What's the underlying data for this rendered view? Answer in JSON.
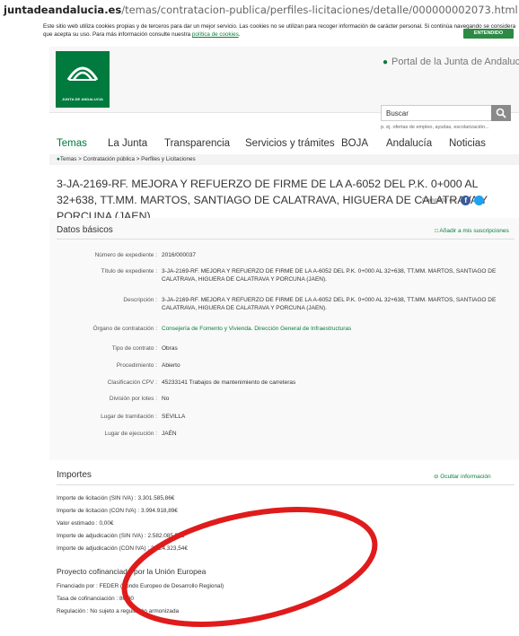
{
  "url": {
    "domain": "juntadeandalucia.es",
    "path": "/temas/contratacion-publica/perfiles-licitaciones/detalle/000000002073.html"
  },
  "cookie_banner": {
    "text": "Este sitio web utiliza cookies propias y de terceros para dar un mejor servicio. Las cookies no se utilizan para recoger información de carácter personal. Si continúa navegando se considera que acepta su uso. Para más información consulte nuestra",
    "link": "política de cookies",
    "button": "ENTENDIDO"
  },
  "header": {
    "logo_text": "JUNTA DE ANDALUCIA",
    "portal_link": "Portal de la Junta de Andalucía",
    "search_value": "Buscar",
    "search_hint": "p. ej. ofertas de empleo, ayudas, escolarización..."
  },
  "nav": [
    "Temas",
    "La Junta",
    "Transparencia",
    "Servicios y trámites",
    "BOJA",
    "Andalucía",
    "Noticias"
  ],
  "breadcrumb": [
    "Temas",
    "Contratación pública",
    "Perfiles y Licitaciones"
  ],
  "title": "3-JA-2169-RF. MEJORA Y REFUERZO DE FIRME DE LA A-6052 DEL P.K. 0+000 AL 32+638, TT.MM. MARTOS, SANTIAGO DE CALATRAVA, HIGUERA DE CALATRAVA Y PORCUNA (JAEN).",
  "share_label": "Compartir en:",
  "datos": {
    "heading": "Datos básicos",
    "subscribe_link": "Añadir a mis suscripciones",
    "rows": [
      {
        "label": "Número de expediente :",
        "value": "2016/000037"
      },
      {
        "label": "Título de expediente :",
        "value": "3-JA-2169-RF. MEJORA Y REFUERZO DE FIRME DE LA A-6052 DEL P.K. 0+000 AL 32+638, TT.MM. MARTOS, SANTIAGO DE CALATRAVA, HIGUERA DE CALATRAVA Y PORCUNA (JAEN)."
      },
      {
        "label": "Descripción :",
        "value": "3-JA-2169-RF. MEJORA Y REFUERZO DE FIRME DE LA A-6052 DEL P.K. 0+000 AL 32+638, TT.MM. MARTOS, SANTIAGO DE CALATRAVA, HIGUERA DE CALATRAVA Y PORCUNA (JAEN)."
      },
      {
        "label": "Órgano de contratación :",
        "value": "Consejería de Fomento y Vivienda. Dirección General de Infraestructuras"
      },
      {
        "label": "Tipo de contrato :",
        "value": "Obras"
      },
      {
        "label": "Procedimiento :",
        "value": "Abierto"
      },
      {
        "label": "Clasificación CPV :",
        "value": "45233141 Trabajos de mantenimiento de carreteras"
      },
      {
        "label": "División por lotes :",
        "value": "No"
      },
      {
        "label": "Lugar de tramitación :",
        "value": "SEVILLA"
      },
      {
        "label": "Lugar de ejecución :",
        "value": "JAÉN"
      }
    ]
  },
  "importes": {
    "heading": "Importes",
    "hide_link": "Ocultar información",
    "lines": [
      "Importe de licitación (SIN IVA) : 3.301.585,86€",
      "Importe de licitación (CON IVA) : 3.994.918,89€",
      "Valor estimado : 0,00€",
      "Importe de adjudicación (SIN IVA) : 2.582.085,57€",
      "Importe de adjudicación (CON IVA) : 3.124.323,54€"
    ],
    "eu_heading": "Proyecto cofinanciado por la Unión Europea",
    "eu_lines": [
      "Financiado por : FEDER (Fondo Europeo de Desarrollo Regional)",
      "Tasa de cofinanciación : 80,00",
      "Regulación : No sujeto a regulación armonizada"
    ]
  },
  "colors": {
    "brand_green": "#007a3d",
    "link_green": "#0a7d3c",
    "annotation_red": "#e01b1b"
  }
}
